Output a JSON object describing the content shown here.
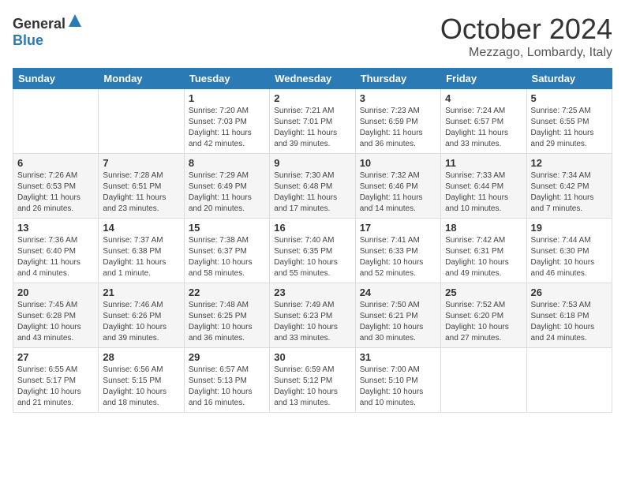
{
  "header": {
    "logo_general": "General",
    "logo_blue": "Blue",
    "month": "October 2024",
    "location": "Mezzago, Lombardy, Italy"
  },
  "weekdays": [
    "Sunday",
    "Monday",
    "Tuesday",
    "Wednesday",
    "Thursday",
    "Friday",
    "Saturday"
  ],
  "weeks": [
    [
      {
        "day": "",
        "info": ""
      },
      {
        "day": "",
        "info": ""
      },
      {
        "day": "1",
        "info": "Sunrise: 7:20 AM\nSunset: 7:03 PM\nDaylight: 11 hours and 42 minutes."
      },
      {
        "day": "2",
        "info": "Sunrise: 7:21 AM\nSunset: 7:01 PM\nDaylight: 11 hours and 39 minutes."
      },
      {
        "day": "3",
        "info": "Sunrise: 7:23 AM\nSunset: 6:59 PM\nDaylight: 11 hours and 36 minutes."
      },
      {
        "day": "4",
        "info": "Sunrise: 7:24 AM\nSunset: 6:57 PM\nDaylight: 11 hours and 33 minutes."
      },
      {
        "day": "5",
        "info": "Sunrise: 7:25 AM\nSunset: 6:55 PM\nDaylight: 11 hours and 29 minutes."
      }
    ],
    [
      {
        "day": "6",
        "info": "Sunrise: 7:26 AM\nSunset: 6:53 PM\nDaylight: 11 hours and 26 minutes."
      },
      {
        "day": "7",
        "info": "Sunrise: 7:28 AM\nSunset: 6:51 PM\nDaylight: 11 hours and 23 minutes."
      },
      {
        "day": "8",
        "info": "Sunrise: 7:29 AM\nSunset: 6:49 PM\nDaylight: 11 hours and 20 minutes."
      },
      {
        "day": "9",
        "info": "Sunrise: 7:30 AM\nSunset: 6:48 PM\nDaylight: 11 hours and 17 minutes."
      },
      {
        "day": "10",
        "info": "Sunrise: 7:32 AM\nSunset: 6:46 PM\nDaylight: 11 hours and 14 minutes."
      },
      {
        "day": "11",
        "info": "Sunrise: 7:33 AM\nSunset: 6:44 PM\nDaylight: 11 hours and 10 minutes."
      },
      {
        "day": "12",
        "info": "Sunrise: 7:34 AM\nSunset: 6:42 PM\nDaylight: 11 hours and 7 minutes."
      }
    ],
    [
      {
        "day": "13",
        "info": "Sunrise: 7:36 AM\nSunset: 6:40 PM\nDaylight: 11 hours and 4 minutes."
      },
      {
        "day": "14",
        "info": "Sunrise: 7:37 AM\nSunset: 6:38 PM\nDaylight: 11 hours and 1 minute."
      },
      {
        "day": "15",
        "info": "Sunrise: 7:38 AM\nSunset: 6:37 PM\nDaylight: 10 hours and 58 minutes."
      },
      {
        "day": "16",
        "info": "Sunrise: 7:40 AM\nSunset: 6:35 PM\nDaylight: 10 hours and 55 minutes."
      },
      {
        "day": "17",
        "info": "Sunrise: 7:41 AM\nSunset: 6:33 PM\nDaylight: 10 hours and 52 minutes."
      },
      {
        "day": "18",
        "info": "Sunrise: 7:42 AM\nSunset: 6:31 PM\nDaylight: 10 hours and 49 minutes."
      },
      {
        "day": "19",
        "info": "Sunrise: 7:44 AM\nSunset: 6:30 PM\nDaylight: 10 hours and 46 minutes."
      }
    ],
    [
      {
        "day": "20",
        "info": "Sunrise: 7:45 AM\nSunset: 6:28 PM\nDaylight: 10 hours and 43 minutes."
      },
      {
        "day": "21",
        "info": "Sunrise: 7:46 AM\nSunset: 6:26 PM\nDaylight: 10 hours and 39 minutes."
      },
      {
        "day": "22",
        "info": "Sunrise: 7:48 AM\nSunset: 6:25 PM\nDaylight: 10 hours and 36 minutes."
      },
      {
        "day": "23",
        "info": "Sunrise: 7:49 AM\nSunset: 6:23 PM\nDaylight: 10 hours and 33 minutes."
      },
      {
        "day": "24",
        "info": "Sunrise: 7:50 AM\nSunset: 6:21 PM\nDaylight: 10 hours and 30 minutes."
      },
      {
        "day": "25",
        "info": "Sunrise: 7:52 AM\nSunset: 6:20 PM\nDaylight: 10 hours and 27 minutes."
      },
      {
        "day": "26",
        "info": "Sunrise: 7:53 AM\nSunset: 6:18 PM\nDaylight: 10 hours and 24 minutes."
      }
    ],
    [
      {
        "day": "27",
        "info": "Sunrise: 6:55 AM\nSunset: 5:17 PM\nDaylight: 10 hours and 21 minutes."
      },
      {
        "day": "28",
        "info": "Sunrise: 6:56 AM\nSunset: 5:15 PM\nDaylight: 10 hours and 18 minutes."
      },
      {
        "day": "29",
        "info": "Sunrise: 6:57 AM\nSunset: 5:13 PM\nDaylight: 10 hours and 16 minutes."
      },
      {
        "day": "30",
        "info": "Sunrise: 6:59 AM\nSunset: 5:12 PM\nDaylight: 10 hours and 13 minutes."
      },
      {
        "day": "31",
        "info": "Sunrise: 7:00 AM\nSunset: 5:10 PM\nDaylight: 10 hours and 10 minutes."
      },
      {
        "day": "",
        "info": ""
      },
      {
        "day": "",
        "info": ""
      }
    ]
  ]
}
